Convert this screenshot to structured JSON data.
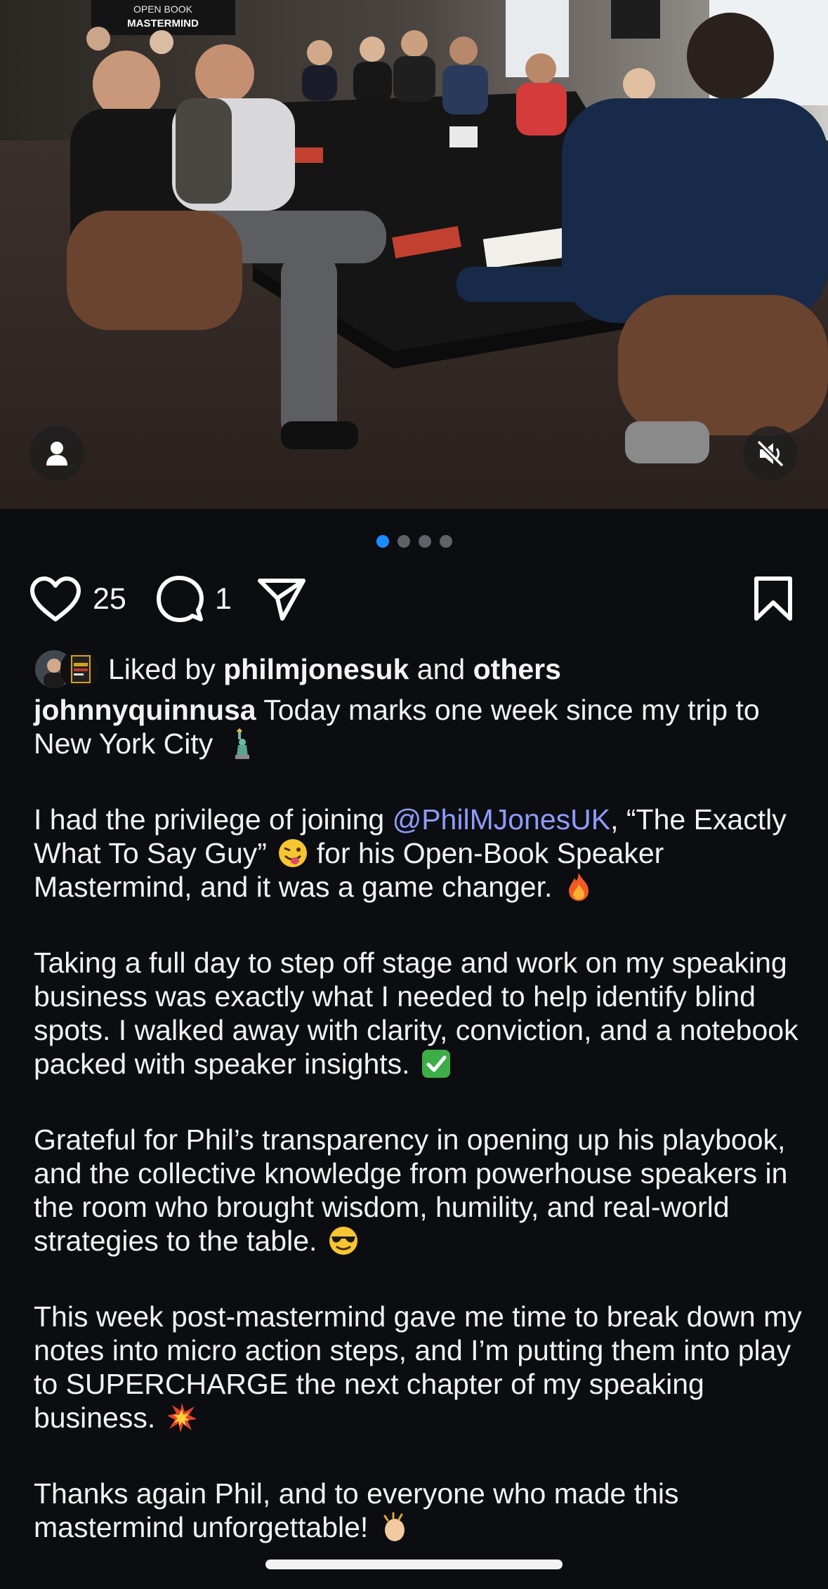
{
  "media": {
    "banner_line1": "OPEN BOOK",
    "banner_line2": "MASTERMIND",
    "carousel_index": 1,
    "carousel_count": 4
  },
  "actions": {
    "like_count": "25",
    "comment_count": "1"
  },
  "liked_by": {
    "prefix": "Liked by",
    "user": "philmjonesuk",
    "conjunction": "and",
    "others": "others"
  },
  "caption": {
    "username": "johnnyquinnusa",
    "p1_text": "Today marks one week since my trip to New York City",
    "p2_pre": "I had the privilege of joining",
    "p2_mention": "@PhilMJonesUK",
    "p2_mid": ", “The Exactly What To Say Guy”",
    "p2_post": "for his Open-Book Speaker Mastermind, and it was a game changer.",
    "p3": "Taking a full day to step off stage and work on my speaking business was exactly what I needed to help identify blind spots. I walked away with clarity, conviction, and a notebook packed with speaker insights.",
    "p4": "Grateful for Phil’s transparency in opening up his playbook, and the collective knowledge from powerhouse speakers in the room who brought wisdom, humility, and real-world strategies to the table.",
    "p5": "This week post-mastermind gave me time to break down my notes into micro action steps, and I’m putting them into play to SUPERCHARGE the next chapter of my speaking business.",
    "p6": "Thanks again Phil, and to everyone who made this mastermind unforgettable!"
  },
  "colors": {
    "background": "#0b0d10",
    "text": "#f5f5f5",
    "mention": "#8f9bff",
    "active_dot": "#1a8cff",
    "inactive_dot": "#5f6266"
  },
  "icons": {
    "like": "heart-icon",
    "comment": "comment-bubble-icon",
    "share": "paper-plane-icon",
    "save": "bookmark-icon",
    "tagged": "person-icon",
    "sound": "speaker-muted-icon"
  }
}
